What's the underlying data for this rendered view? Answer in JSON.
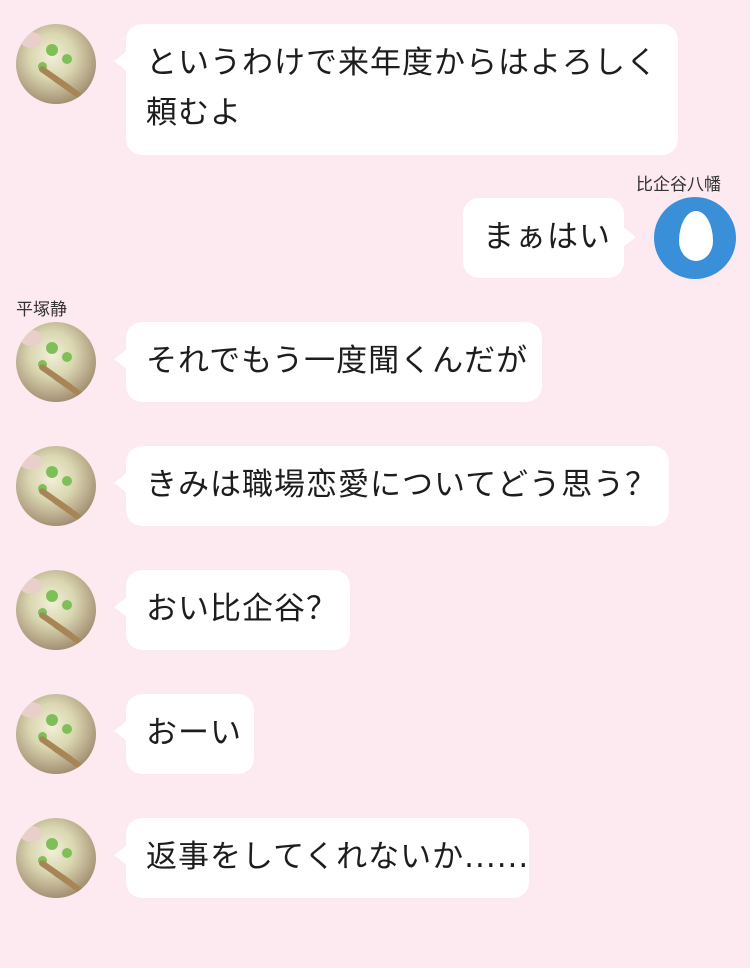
{
  "colors": {
    "background": "#fde9f0",
    "bubble": "#ffffff",
    "self_avatar": "#3a8fd9"
  },
  "participants": {
    "self_name": "比企谷八幡",
    "other_name": "平塚静"
  },
  "messages": [
    {
      "side": "left",
      "line1": "というわけで来年度からはよろしく",
      "line2": "頼むよ"
    },
    {
      "side": "right",
      "text": "まぁはい"
    },
    {
      "side": "left",
      "text": "それでもう一度聞くんだが"
    },
    {
      "side": "left",
      "text": "きみは職場恋愛についてどう思う？"
    },
    {
      "side": "left",
      "text": "おい比企谷？"
    },
    {
      "side": "left",
      "text": "おーい"
    },
    {
      "side": "left",
      "text": "返事をしてくれないか......"
    }
  ]
}
